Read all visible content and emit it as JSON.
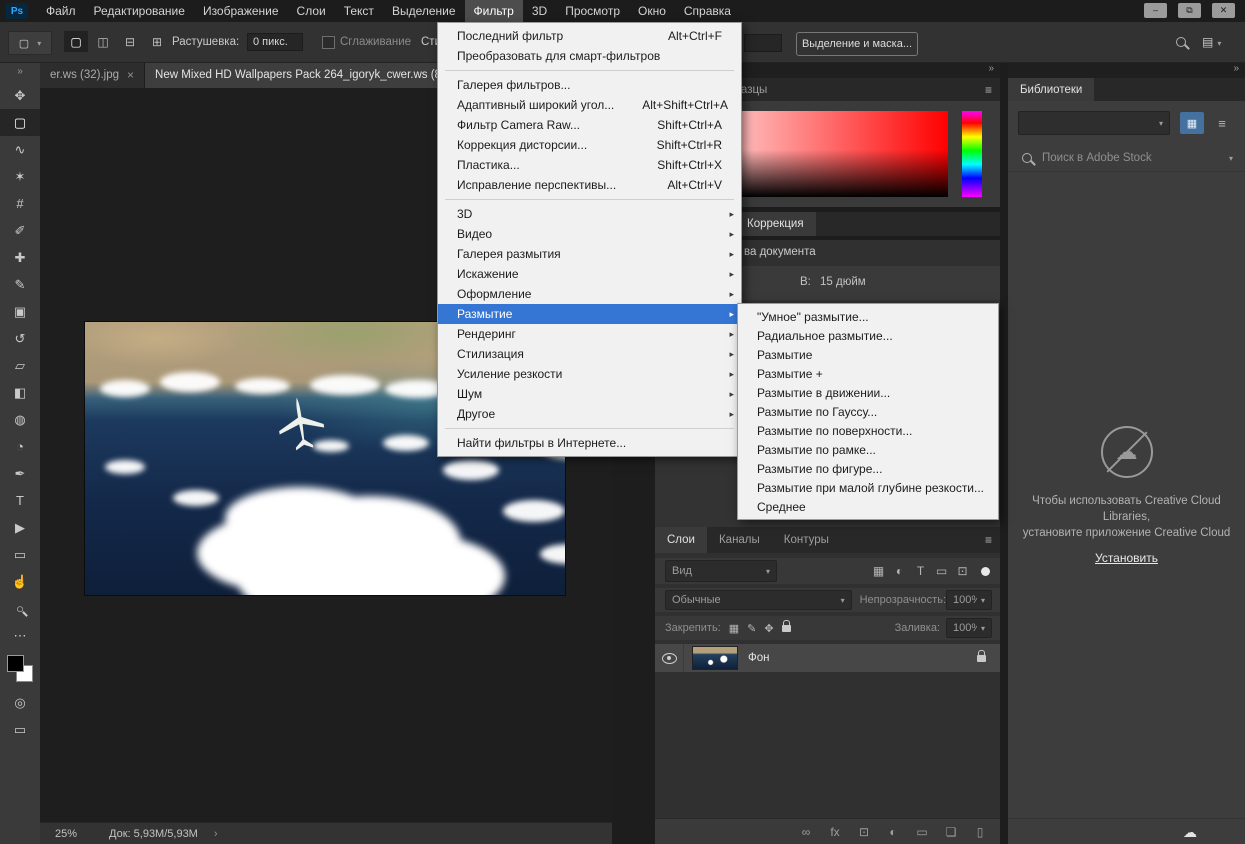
{
  "window": {
    "minimize": "–",
    "restore": "⧉",
    "close": "✕"
  },
  "icons": {
    "hamburger": "≡",
    "dropdown": "▾",
    "collapse": "»",
    "grid": "▦",
    "list": "≡",
    "cloud": "☁",
    "workspace": "▤"
  },
  "menubar": {
    "logo": "Ps",
    "items": [
      {
        "label": "Файл"
      },
      {
        "label": "Редактирование"
      },
      {
        "label": "Изображение"
      },
      {
        "label": "Слои"
      },
      {
        "label": "Текст"
      },
      {
        "label": "Выделение"
      },
      {
        "label": "Фильтр",
        "state": "active"
      },
      {
        "label": "3D"
      },
      {
        "label": "Просмотр"
      },
      {
        "label": "Окно"
      },
      {
        "label": "Справка"
      }
    ]
  },
  "options_bar": {
    "mode_buttons": [
      {
        "name": "new-selection-button",
        "glyph": "▢",
        "state": "active"
      },
      {
        "name": "add-selection-button",
        "glyph": "◫"
      },
      {
        "name": "subtract-selection-button",
        "glyph": "⊟"
      },
      {
        "name": "intersect-selection-button",
        "glyph": "⊞"
      }
    ],
    "feather_label": "Растушевка:",
    "feather_value": "0 пикс.",
    "antialias_label": "Сглаживание",
    "style_label_fragment": "Сти",
    "select_mask_button": "Выделение и маска..."
  },
  "toolbar": {
    "tools": [
      {
        "name": "move-tool",
        "glyph": "✥"
      },
      {
        "name": "rect-marquee-tool",
        "glyph": "▢",
        "state": "active"
      },
      {
        "name": "lasso-tool",
        "glyph": "∿"
      },
      {
        "name": "quick-selection-tool",
        "glyph": "✶"
      },
      {
        "name": "crop-tool",
        "glyph": "#"
      },
      {
        "name": "eyedropper-tool",
        "glyph": "✐"
      },
      {
        "name": "healing-brush-tool",
        "glyph": "✚"
      },
      {
        "name": "brush-tool",
        "glyph": "✎"
      },
      {
        "name": "clone-stamp-tool",
        "glyph": "▣"
      },
      {
        "name": "history-brush-tool",
        "glyph": "↺"
      },
      {
        "name": "eraser-tool",
        "glyph": "▱"
      },
      {
        "name": "gradient-tool",
        "glyph": "◧"
      },
      {
        "name": "blur-tool",
        "glyph": "◍"
      },
      {
        "name": "dodge-tool",
        "glyph": "◔"
      },
      {
        "name": "pen-tool",
        "glyph": "✒"
      },
      {
        "name": "type-tool",
        "glyph": "T"
      },
      {
        "name": "path-selection-tool",
        "glyph": "▶"
      },
      {
        "name": "shape-tool",
        "glyph": "▭"
      },
      {
        "name": "hand-tool",
        "glyph": "☝"
      },
      {
        "name": "zoom-tool",
        "glyph": "○"
      },
      {
        "name": "edit-toolbar-button",
        "glyph": "⋯"
      }
    ],
    "bottom_tools": [
      {
        "name": "quick-mask-button",
        "glyph": "◎"
      },
      {
        "name": "screen-mode-button",
        "glyph": "▭"
      }
    ]
  },
  "document": {
    "tabs": [
      {
        "label": "er.ws (32).jpg",
        "close": "×"
      },
      {
        "label": "New Mixed HD Wallpapers Pack 264_igoryk_cwer.ws (8",
        "state": "active"
      }
    ],
    "status": {
      "zoom": "25%",
      "doc_info": "Док: 5,93М/5,93М",
      "chevron": "›"
    }
  },
  "filter_menu": {
    "items": [
      {
        "label": "Последний фильтр",
        "shortcut": "Alt+Ctrl+F"
      },
      {
        "label": "Преобразовать для смарт-фильтров"
      },
      {
        "state": "sep"
      },
      {
        "label": "Галерея фильтров..."
      },
      {
        "label": "Адаптивный широкий угол...",
        "shortcut": "Alt+Shift+Ctrl+A"
      },
      {
        "label": "Фильтр Camera Raw...",
        "shortcut": "Shift+Ctrl+A"
      },
      {
        "label": "Коррекция дисторсии...",
        "shortcut": "Shift+Ctrl+R"
      },
      {
        "label": "Пластика...",
        "shortcut": "Shift+Ctrl+X"
      },
      {
        "label": "Исправление перспективы...",
        "shortcut": "Alt+Ctrl+V"
      },
      {
        "state": "sep"
      },
      {
        "label": "3D",
        "arrow": "▸"
      },
      {
        "label": "Видео",
        "arrow": "▸"
      },
      {
        "label": "Галерея размытия",
        "arrow": "▸"
      },
      {
        "label": "Искажение",
        "arrow": "▸"
      },
      {
        "label": "Оформление",
        "arrow": "▸"
      },
      {
        "label": "Размытие",
        "arrow": "▸",
        "state": "hl"
      },
      {
        "label": "Рендеринг",
        "arrow": "▸"
      },
      {
        "label": "Стилизация",
        "arrow": "▸"
      },
      {
        "label": "Усиление резкости",
        "arrow": "▸"
      },
      {
        "label": "Шум",
        "arrow": "▸"
      },
      {
        "label": "Другое",
        "arrow": "▸"
      },
      {
        "state": "sep"
      },
      {
        "label": "Найти фильтры в Интернете..."
      }
    ]
  },
  "blur_submenu": {
    "items": [
      {
        "label": "\"Умное\" размытие..."
      },
      {
        "label": "Радиальное размытие..."
      },
      {
        "label": "Размытие"
      },
      {
        "label": "Размытие +"
      },
      {
        "label": "Размытие в движении..."
      },
      {
        "label": "Размытие по Гауссу..."
      },
      {
        "label": "Размытие по поверхности..."
      },
      {
        "label": "Размытие по рамке..."
      },
      {
        "label": "Размытие по фигуре..."
      },
      {
        "label": "Размытие при малой глубине резкости..."
      },
      {
        "label": "Среднее"
      }
    ]
  },
  "panels": {
    "color": {
      "swatches_tab": "Образцы"
    },
    "adjustments": {
      "tab": "Коррекция"
    },
    "properties": {
      "header": "ва документа",
      "height_label": "В:",
      "height_value": "15 дюйм"
    },
    "layers": {
      "tabs": [
        {
          "label": "Слои",
          "state": "active"
        },
        {
          "label": "Каналы"
        },
        {
          "label": "Контуры"
        }
      ],
      "filter_label": "Вид",
      "filter_icons": [
        {
          "name": "filter-pixel-icon",
          "glyph": "▦"
        },
        {
          "name": "filter-adjustment-icon",
          "glyph": "◐"
        },
        {
          "name": "filter-type-icon",
          "glyph": "T"
        },
        {
          "name": "filter-shape-icon",
          "glyph": "▭"
        },
        {
          "name": "filter-smart-object-icon",
          "glyph": "⊡"
        }
      ],
      "blend_mode": "Обычные",
      "opacity_label": "Непрозрачность:",
      "opacity_value": "100%",
      "lock_label": "Закрепить:",
      "lock_icons": [
        {
          "name": "lock-transparency-icon",
          "glyph": "▦"
        },
        {
          "name": "lock-pixels-icon",
          "glyph": "✎"
        },
        {
          "name": "lock-position-icon",
          "glyph": "✥"
        }
      ],
      "fill_label": "Заливка:",
      "fill_value": "100%",
      "layer_name": "Фон",
      "bottom_icons": [
        {
          "name": "link-layers-icon",
          "glyph": "∞"
        },
        {
          "name": "layer-effects-icon",
          "glyph": "fx"
        },
        {
          "name": "layer-mask-icon",
          "glyph": "⊡"
        },
        {
          "name": "adjustment-layer-icon",
          "glyph": "◐"
        },
        {
          "name": "layer-group-icon",
          "glyph": "▭"
        },
        {
          "name": "new-layer-icon",
          "glyph": "❏"
        },
        {
          "name": "delete-layer-icon",
          "glyph": "▯"
        }
      ]
    },
    "libraries": {
      "tab": "Библиотеки",
      "search_placeholder": "Поиск в Adobe Stock",
      "message_lines": [
        "Чтобы использовать Creative Cloud",
        "Libraries,",
        "установите приложение Creative Cloud"
      ],
      "install_link": "Установить"
    }
  }
}
